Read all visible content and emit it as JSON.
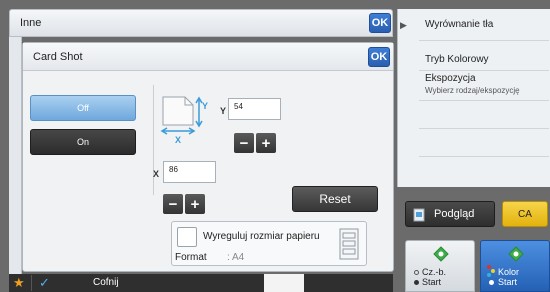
{
  "header": {
    "title": "Inne",
    "ok_label": "OK"
  },
  "right_panel": {
    "items": [
      {
        "label": "Wyrównanie tła",
        "sub": ""
      },
      {
        "label": "Tryb Kolorowy",
        "sub": ""
      },
      {
        "label": "Ekspozycja",
        "sub": "Wybierz rodzaj/ekspozycję"
      }
    ]
  },
  "dialog": {
    "title": "Card Shot",
    "ok_label": "OK",
    "off_label": "Off",
    "on_label": "On",
    "y_label": "Y",
    "y_value": "54",
    "x_label": "X",
    "x_value": "86",
    "minus": "−",
    "plus": "+",
    "reset_label": "Reset",
    "fit_paper_label": "Wyreguluj rozmiar papieru",
    "format_label": "Format",
    "format_value": ": A4"
  },
  "bottom_toolbar": {
    "back_label": "Cofnij"
  },
  "actions": {
    "preview_label": "Podgląd",
    "ca_label": "CA",
    "start_bw": {
      "line1": "Cz.-b.",
      "line2": "Start"
    },
    "start_color": {
      "line1": "Kolor",
      "line2": "Start"
    }
  },
  "colors": {
    "accent": "#2a5fb0",
    "selected_toggle": "#6fa8dc",
    "ca_button": "#e3b20d",
    "start_green": "#3fae4a"
  }
}
